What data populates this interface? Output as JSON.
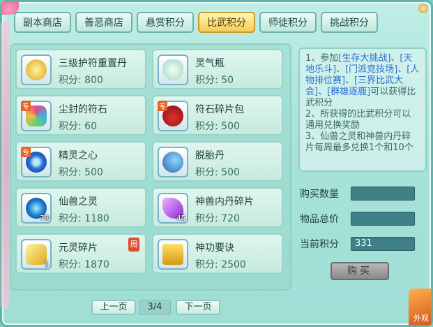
{
  "tabs": [
    {
      "label": "副本商店",
      "active": false
    },
    {
      "label": "善恶商店",
      "active": false
    },
    {
      "label": "悬赏积分",
      "active": false
    },
    {
      "label": "比武积分",
      "active": true
    },
    {
      "label": "师徒积分",
      "active": false
    },
    {
      "label": "挑战积分",
      "active": false
    }
  ],
  "items": [
    {
      "name": "三级护符重置丹",
      "price": "积分: 800",
      "icon": "golden-amulet-icon",
      "tag": "",
      "count": "",
      "weekly": ""
    },
    {
      "name": "灵气瓶",
      "price": "积分: 50",
      "icon": "spirit-bottle-icon",
      "tag": "",
      "count": "",
      "weekly": ""
    },
    {
      "name": "尘封的符石",
      "price": "积分: 60",
      "icon": "sealed-rune-stone-icon",
      "tag": "专",
      "count": "",
      "weekly": ""
    },
    {
      "name": "符石碎片包",
      "price": "积分: 500",
      "icon": "rune-fragment-bag-icon",
      "tag": "专",
      "count": "",
      "weekly": ""
    },
    {
      "name": "精灵之心",
      "price": "积分: 500",
      "icon": "spirit-heart-icon",
      "tag": "专",
      "count": "",
      "weekly": ""
    },
    {
      "name": "脱胎丹",
      "price": "积分: 500",
      "icon": "rebirth-pill-icon",
      "tag": "",
      "count": "",
      "weekly": ""
    },
    {
      "name": "仙兽之灵",
      "price": "积分: 1180",
      "icon": "beast-spirit-orb-icon",
      "tag": "",
      "count": "79",
      "weekly": ""
    },
    {
      "name": "神兽内丹碎片",
      "price": "积分: 720",
      "icon": "beast-core-shard-icon",
      "tag": "",
      "count": "45",
      "weekly": ""
    },
    {
      "name": "元灵碎片",
      "price": "积分: 1870",
      "icon": "soul-fragment-icon",
      "tag": "",
      "count": "1",
      "weekly": "周"
    },
    {
      "name": "神功要诀",
      "price": "积分: 2500",
      "icon": "skill-manual-icon",
      "tag": "",
      "count": "",
      "weekly": ""
    }
  ],
  "info": {
    "line1_pre": "1、参加",
    "line1_hl": "[生存大挑战]、[天地乐斗]、[门派竞技场]、[人物排位赛]、[三界比武大会]、[群雄逐鹿]",
    "line1_post": "可以获得比武积分",
    "line2": "2、所获得的比武积分可以通用兑换奖励",
    "line3": "3、仙兽之灵和神兽内丹碎片每周最多兑换1个和10个"
  },
  "purchase": {
    "qty_label": "购买数量",
    "qty_value": "",
    "total_label": "物品总价",
    "total_value": "",
    "points_label": "当前积分",
    "points_value": "331",
    "buy_label": "购买"
  },
  "pager": {
    "prev": "上一页",
    "page": "3/4",
    "next": "下一页"
  },
  "corner_label": "外观",
  "colors": {
    "accent": "#f3cd56",
    "panel": "#a9e3db",
    "highlight_text": "#2a6fd6"
  }
}
